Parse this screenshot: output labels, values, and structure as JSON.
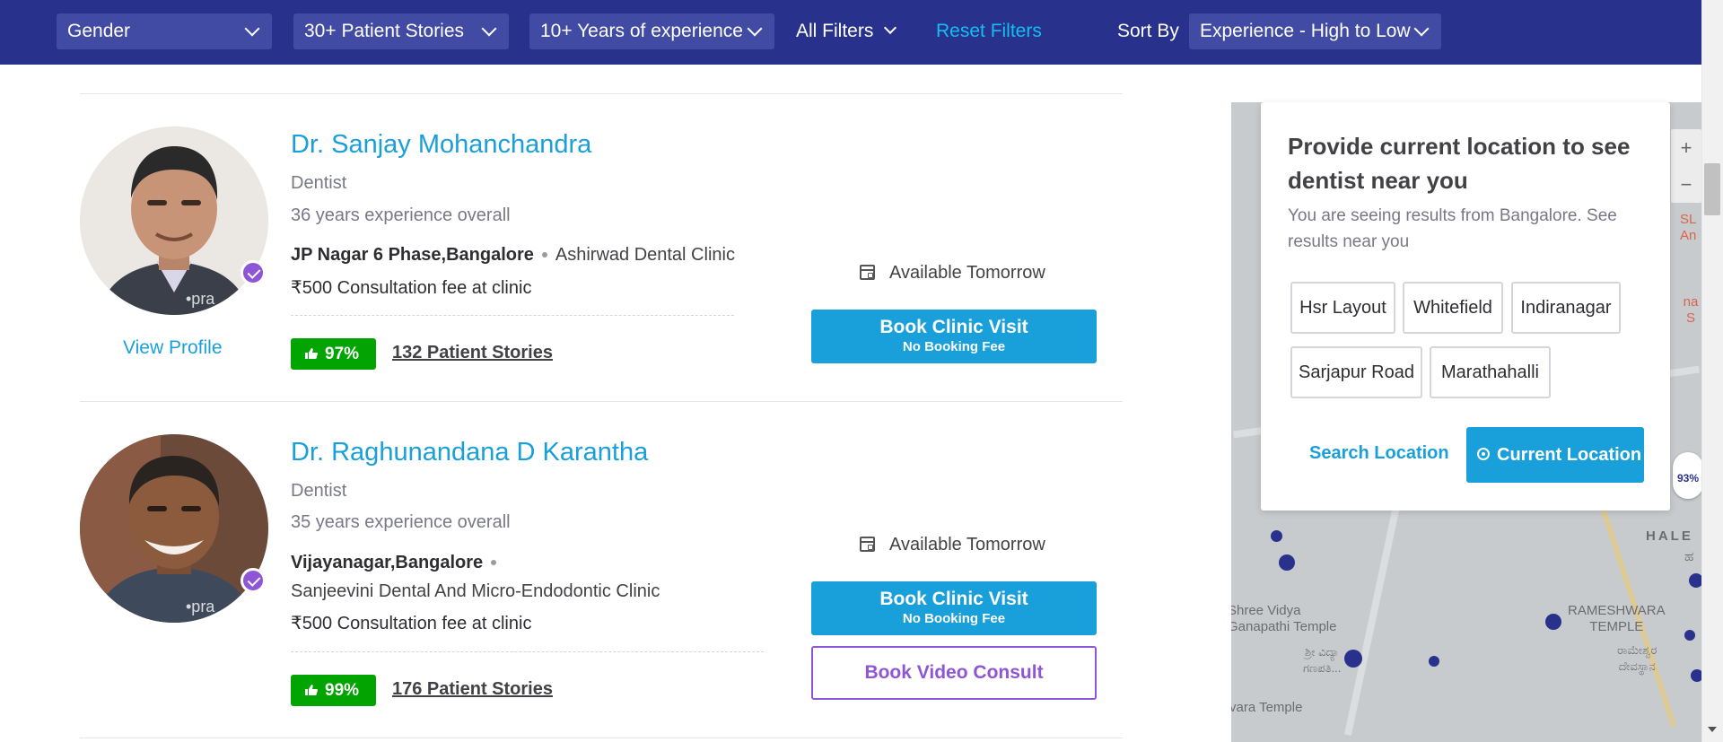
{
  "filters": {
    "gender": "Gender",
    "stories": "30+ Patient Stories",
    "experience": "10+ Years of experience",
    "all_filters": "All Filters",
    "reset": "Reset Filters",
    "sort_label": "Sort By",
    "sort_value": "Experience - High to Low"
  },
  "doctors": [
    {
      "name": "Dr. Sanjay Mohanchandra",
      "specialty": "Dentist",
      "experience": "36 years experience overall",
      "locality": "JP Nagar 6 Phase,Bangalore",
      "clinic": "Ashirwad Dental Clinic",
      "fee": "₹500 Consultation fee at clinic",
      "rating": "97%",
      "stories": "132 Patient Stories",
      "view_profile": "View Profile",
      "availability": "Available Tomorrow",
      "book_label": "Book Clinic Visit",
      "book_sub": "No Booking Fee",
      "watermark": "•pra"
    },
    {
      "name": "Dr. Raghunandana D Karantha",
      "specialty": "Dentist",
      "experience": "35 years experience overall",
      "locality": "Vijayanagar,Bangalore",
      "clinic": "Sanjeevini Dental And Micro-Endodontic Clinic",
      "fee": "₹500 Consultation fee at clinic",
      "rating": "99%",
      "stories": "176 Patient Stories",
      "availability": "Available Tomorrow",
      "book_label": "Book Clinic Visit",
      "book_sub": "No Booking Fee",
      "video_label": "Book Video Consult",
      "watermark": "•pra"
    }
  ],
  "location_popup": {
    "title": "Provide current location to see dentist near you",
    "subtitle": "You are seeing results from Bangalore. See results near you",
    "chips": [
      "Hsr Layout",
      "Whitefield",
      "Indiranagar",
      "Sarjapur Road",
      "Marathahalli"
    ],
    "search_label": "Search Location",
    "current_label": "Current Location"
  },
  "map": {
    "zoom_in": "+",
    "zoom_out": "−",
    "labels": {
      "hale": "HALE",
      "hale_kn": "ಹ",
      "temple1": "Shree Vidya\nGanapathi Temple",
      "temple1_kn": "ಶ್ರೀ ವಿದ್ಯಾ\nಗಣಪತಿ...",
      "temple2": "RAMESHWARA\nTEMPLE",
      "temple2_kn": "ರಾಮೇಶ್ವರ\nದೇವಸ್ಥಾನ",
      "temple3": "vara Temple",
      "edge1": "SL\nAn",
      "edge2": "na S",
      "pin_rating": "93%"
    }
  },
  "colors": {
    "header": "#28328c",
    "link": "#199fd9",
    "rating": "#01a400",
    "verified": "#8e55d6"
  }
}
